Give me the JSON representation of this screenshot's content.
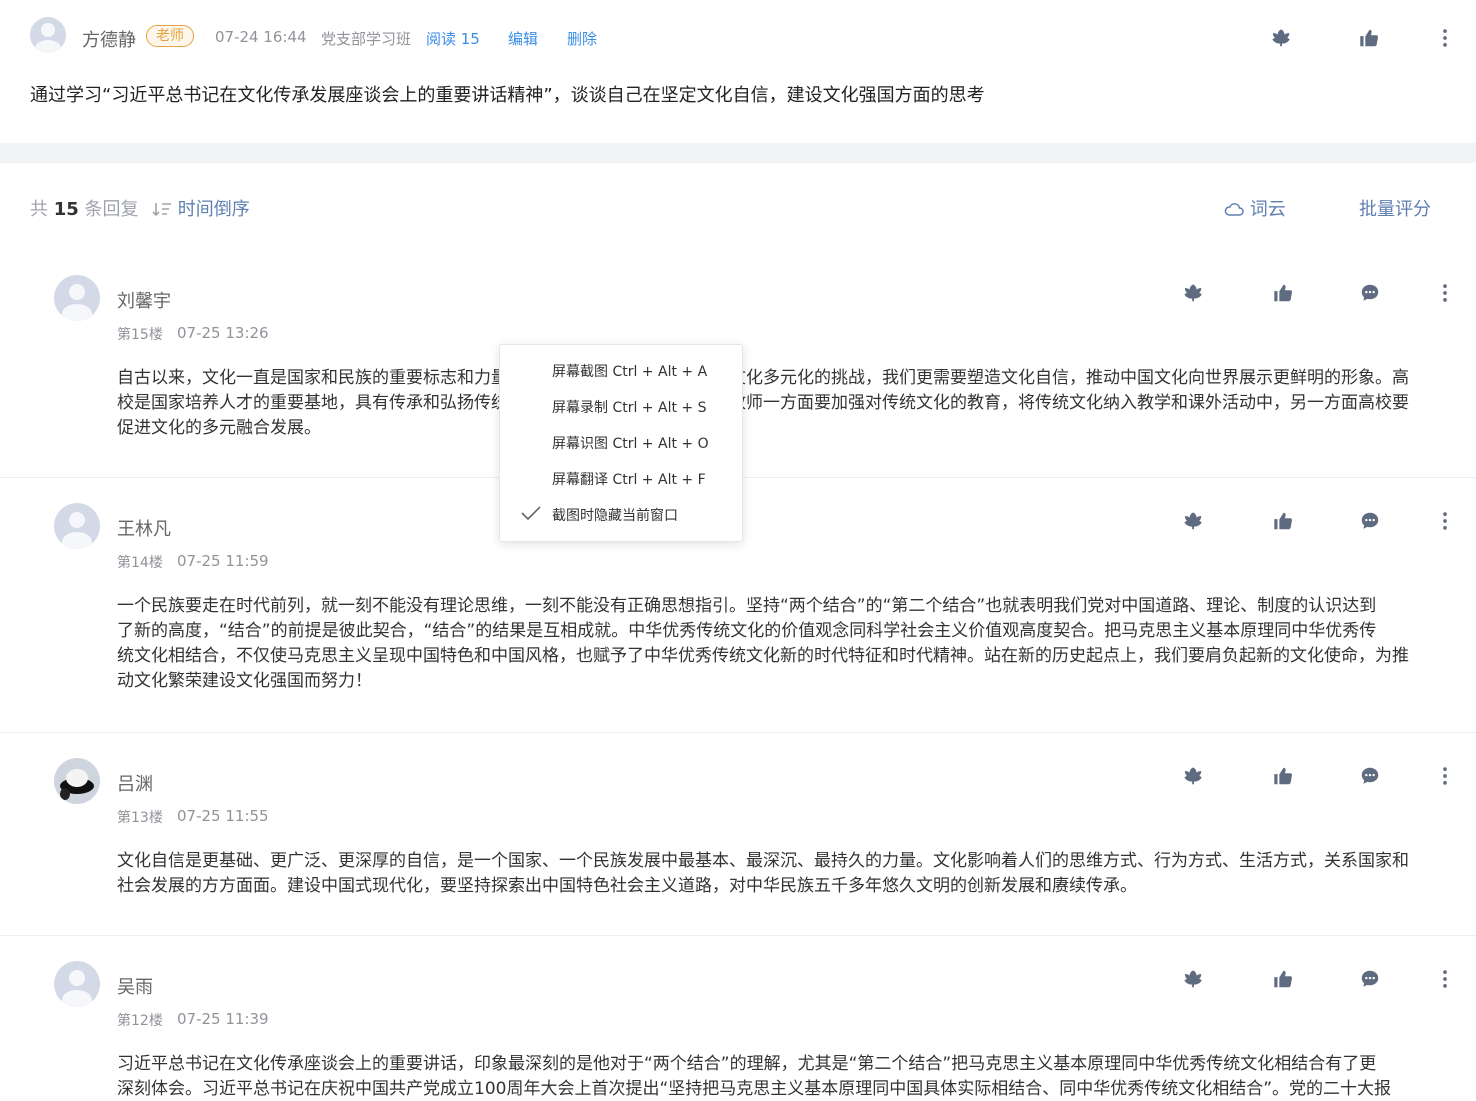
{
  "post": {
    "author": "方德静",
    "role_badge": "老师",
    "time": "07-24 16:44",
    "group": "党支部学习班",
    "reads": "阅读 15",
    "edit": "编辑",
    "delete": "删除",
    "title": "通过学习“习近平总书记在文化传承发展座谈会上的重要讲话精神”，谈谈自己在坚定文化自信，建设文化强国方面的思考"
  },
  "reply_bar": {
    "prefix": "共",
    "count": "15",
    "suffix": "条回复",
    "sort": "时间倒序",
    "wordcloud": "词云",
    "batch": "批量评分"
  },
  "replies": [
    {
      "name": "刘馨宇",
      "floor": "第15楼",
      "time": "07-25 13:26",
      "lines": [
        "自古以来，文化一直是国家和民族的重要标志和力量。在当代社会，面对全球化和文化多元化的挑战，我们更需要塑造文化自信，推动中国文化向世界展示更鲜明的形象。高",
        "校是国家培养人才的重要基地，具有传承和弘扬传统文化的重要责任。一方面高校教师一方面要加强对传统文化的教育，将传统文化纳入教学和课外活动中，另一方面高校要",
        "促进文化的多元融合发展。"
      ]
    },
    {
      "name": "王林凡",
      "floor": "第14楼",
      "time": "07-25 11:59",
      "lines": [
        "一个民族要走在时代前列，就一刻不能没有理论思维，一刻不能没有正确思想指引。坚持“两个结合”的“第二个结合”也就表明我们党对中国道路、理论、制度的认识达到",
        "了新的高度，“结合”的前提是彼此契合，“结合”的结果是互相成就。中华优秀传统文化的价值观念同科学社会主义价值观高度契合。把马克思主义基本原理同中华优秀传",
        "统文化相结合，不仅使马克思主义呈现中国特色和中国风格，也赋予了中华优秀传统文化新的时代特征和时代精神。站在新的历史起点上，我们要肩负起新的文化使命，为推",
        "动文化繁荣建设文化强国而努力！"
      ]
    },
    {
      "name": "吕渊",
      "floor": "第13楼",
      "time": "07-25 11:55",
      "lines": [
        "文化自信是更基础、更广泛、更深厚的自信，是一个国家、一个民族发展中最基本、最深沉、最持久的力量。文化影响着人们的思维方式、行为方式、生活方式，关系国家和",
        "社会发展的方方面面。建设中国式现代化，要坚持探索出中国特色社会主义道路，对中华民族五千多年悠久文明的创新发展和赓续传承。"
      ]
    },
    {
      "name": "吴雨",
      "floor": "第12楼",
      "time": "07-25 11:39",
      "lines": [
        "习近平总书记在文化传承座谈会上的重要讲话，印象最深刻的是他对于“两个结合”的理解，尤其是“第二个结合”把马克思主义基本原理同中华优秀传统文化相结合有了更",
        "深刻体会。习近平总书记在庆祝中国共产党成立100周年大会上首次提出“坚持把马克思主义基本原理同中国具体实际相结合、同中华优秀传统文化相结合”。党的二十大报"
      ]
    }
  ],
  "context_menu": {
    "items": [
      "屏幕截图 Ctrl + Alt + A",
      "屏幕录制 Ctrl + Alt + S",
      "屏幕识图 Ctrl + Alt + O",
      "屏幕翻译 Ctrl + Alt + F",
      "截图时隐藏当前窗口"
    ]
  },
  "icons": [
    "flower-icon",
    "thumbs-up-icon",
    "comment-icon",
    "more-icon",
    "cloud-icon",
    "sort-desc-icon",
    "check-icon"
  ],
  "colors": {
    "link": "#3a8ee6",
    "badge": "#e6a23c",
    "badge_bg": "#fdf6ec",
    "muted": "#909399",
    "icon": "#5f6b80",
    "divider_band": "#f2f3f5"
  }
}
